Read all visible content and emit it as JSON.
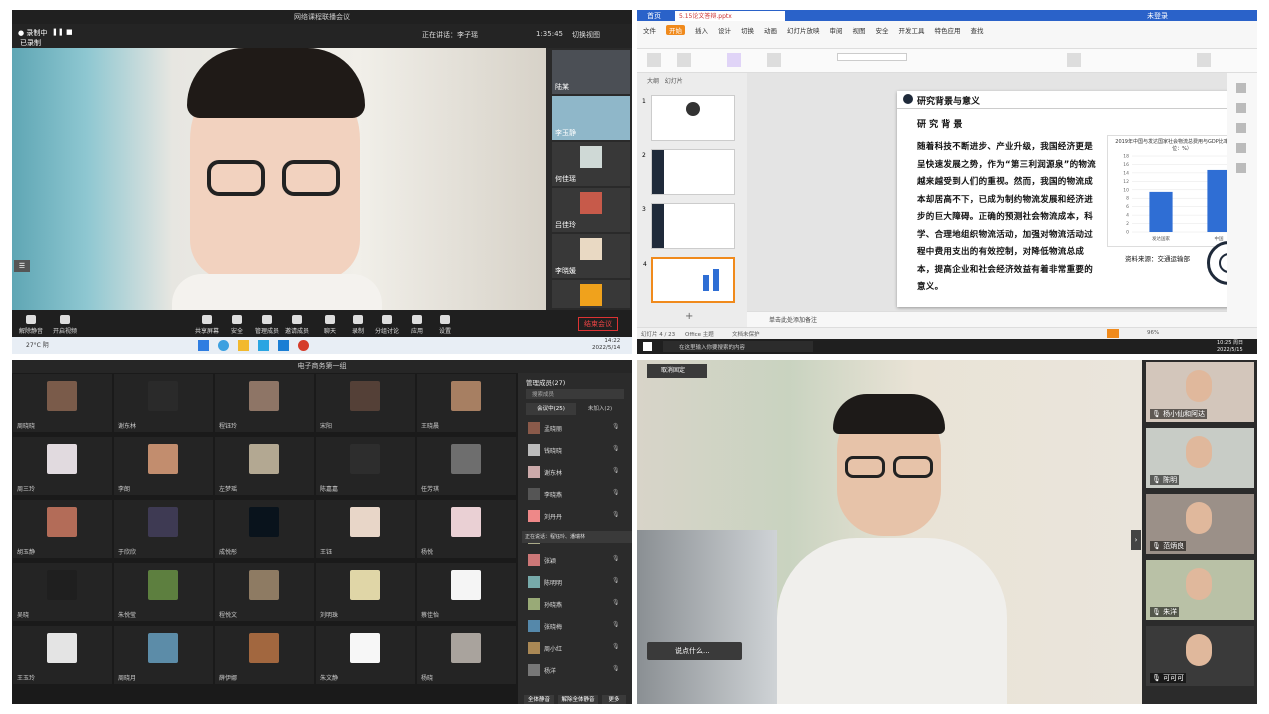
{
  "q1": {
    "window_title": "网络课程联播会议",
    "status_left": "● 录制中",
    "recording_text": "已录制",
    "speaker_text": "正在讲话：李子瑶",
    "timer": "1:35:45",
    "gallery_label": "切换视图",
    "side_names": [
      "陆某",
      "李玉静",
      "何佳瑶",
      "吕佳玲",
      "李晓媛"
    ],
    "toolbar": [
      "解除静音",
      "开启视频",
      "共享屏幕",
      "安全",
      "管理成员",
      "邀请成员",
      "聊天",
      "录制",
      "分组讨论",
      "应用",
      "设置"
    ],
    "end_button": "结束会议",
    "taskbar_weather": "27°C 阴",
    "taskbar_time": "14:22",
    "taskbar_date": "2022/5/14"
  },
  "q2": {
    "tab_home": "首页",
    "tab_doc": "5.15论文答辩.pptx",
    "user_label": "未登录",
    "menus": [
      "文件",
      "开始",
      "插入",
      "设计",
      "切换",
      "动画",
      "幻灯片放映",
      "审阅",
      "视图",
      "安全",
      "开发工具",
      "特色应用",
      "查找"
    ],
    "slide_heading": "研究背景与意义",
    "slide_subheading": "研 究 背 景",
    "slide_body": "随着科技不断进步、产业升级，我国经济更是呈快速发展之势，作为“第三利润源泉”的物流越来越受到人们的重视。然而，我国的物流成本却居高不下，已成为制约物流发展和经济进步的巨大障碍。正确的预测社会物流成本，科学、合理地组织物流活动，加强对物流活动过程中费用支出的有效控制，对降低物流总成本，提高企业和社会经济效益有着非常重要的意义。",
    "chart_title": "2019年中国与发达国家社会物流总费用与GDP比率情况（单位：%）",
    "source_text": "资料来源：交通运输部",
    "notes_text": "单击此处添加备注",
    "status_left": "幻灯片 4 / 23",
    "status_theme": "Office 主题",
    "status_protect": "文档未保护",
    "zoom": "96%",
    "search_placeholder": "在这里输入你要搜索的内容",
    "time": "10:25 周日",
    "date": "2022/5/15",
    "slide_numbers": [
      "1",
      "2",
      "3",
      "4"
    ]
  },
  "q3": {
    "window_title": "电子商务第一组",
    "panel_title": "管理成员(27)",
    "panel_tabs": [
      "会议中(25)",
      "未加入(2)"
    ],
    "search_placeholder": "搜索成员",
    "participants": [
      "孟晓丽",
      "钱晓晓",
      "谢东林",
      "李晓燕",
      "刘丹丹",
      "李欣然",
      "张颖",
      "陈明明",
      "孙晓燕",
      "张晓梅",
      "周小红",
      "杨洋"
    ],
    "tile_names": [
      "周晓晓",
      "谢东林",
      "程钰玲",
      "宋阳",
      "王晓晨",
      "周三玲",
      "李朗",
      "左梦瑶",
      "陈嘉嘉",
      "任芳琪",
      "胡玉静",
      "于欣欣",
      "成悦彤",
      "王钰",
      "杨悦",
      "吴晓",
      "朱悦莹",
      "程悦文",
      "刘明珠",
      "蔡佳怡",
      "王玉玲",
      "周晓月",
      "薛伊娜",
      "朱文静",
      "杨晓"
    ],
    "bottom_buttons": [
      "全体静音",
      "解除全体静音",
      "更多"
    ],
    "chat_bubble": "正在说话：程钰玲、潘瑞林"
  },
  "q4": {
    "cancel_pin": "取消固定",
    "chat_placeholder": "说点什么...",
    "side_names": [
      "杨小仙和阿达",
      "陈明",
      "范炳良",
      "朱洋",
      "可可可"
    ]
  },
  "chart_data": {
    "type": "bar",
    "title": "2019年中国与发达国家社会物流总费用与GDP比率情况（单位：%）",
    "categories": [
      "发达国家",
      "中国"
    ],
    "values": [
      9.5,
      14.7
    ],
    "ylim": [
      0,
      18
    ],
    "yticks": [
      0,
      2,
      4,
      6,
      8,
      10,
      12,
      14,
      16,
      18
    ],
    "color": "#2f6ed4"
  }
}
